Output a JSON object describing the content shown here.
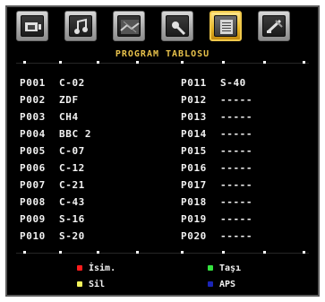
{
  "menu": {
    "title": "PROGRAM TABLOSU",
    "tabs": [
      {
        "name": "picture-tab",
        "icon": "picture-icon",
        "active": false
      },
      {
        "name": "sound-tab",
        "icon": "music-note-icon",
        "active": false
      },
      {
        "name": "features-tab",
        "icon": "features-icon",
        "active": false
      },
      {
        "name": "install-tab",
        "icon": "wrench-icon",
        "active": false
      },
      {
        "name": "program-table-tab",
        "icon": "list-icon",
        "active": true
      },
      {
        "name": "source-tab",
        "icon": "plug-icon",
        "active": false
      }
    ]
  },
  "programs": {
    "left": [
      {
        "num": "P001",
        "name": "C-02"
      },
      {
        "num": "P002",
        "name": "ZDF"
      },
      {
        "num": "P003",
        "name": "CH4"
      },
      {
        "num": "P004",
        "name": "BBC 2"
      },
      {
        "num": "P005",
        "name": "C-07"
      },
      {
        "num": "P006",
        "name": "C-12"
      },
      {
        "num": "P007",
        "name": "C-21"
      },
      {
        "num": "P008",
        "name": "C-43"
      },
      {
        "num": "P009",
        "name": "S-16"
      },
      {
        "num": "P010",
        "name": "S-20"
      }
    ],
    "right": [
      {
        "num": "P011",
        "name": "S-40"
      },
      {
        "num": "P012",
        "name": "-----"
      },
      {
        "num": "P013",
        "name": "-----"
      },
      {
        "num": "P014",
        "name": "-----"
      },
      {
        "num": "P015",
        "name": "-----"
      },
      {
        "num": "P016",
        "name": "-----"
      },
      {
        "num": "P017",
        "name": "-----"
      },
      {
        "num": "P018",
        "name": "-----"
      },
      {
        "num": "P019",
        "name": "-----"
      },
      {
        "num": "P020",
        "name": "-----"
      }
    ]
  },
  "footer": {
    "red": {
      "label": "İsim.",
      "color": "#ff1c1c"
    },
    "green": {
      "label": "Taşı",
      "color": "#34e23f"
    },
    "yellow": {
      "label": "Sil",
      "color": "#f3f35b"
    },
    "blue": {
      "label": "APS",
      "color": "#1b25b8"
    }
  },
  "colors": {
    "title": "#e7c14b",
    "text": "#f2f2f2",
    "background": "#000000",
    "tab_active": "#e6b425"
  }
}
